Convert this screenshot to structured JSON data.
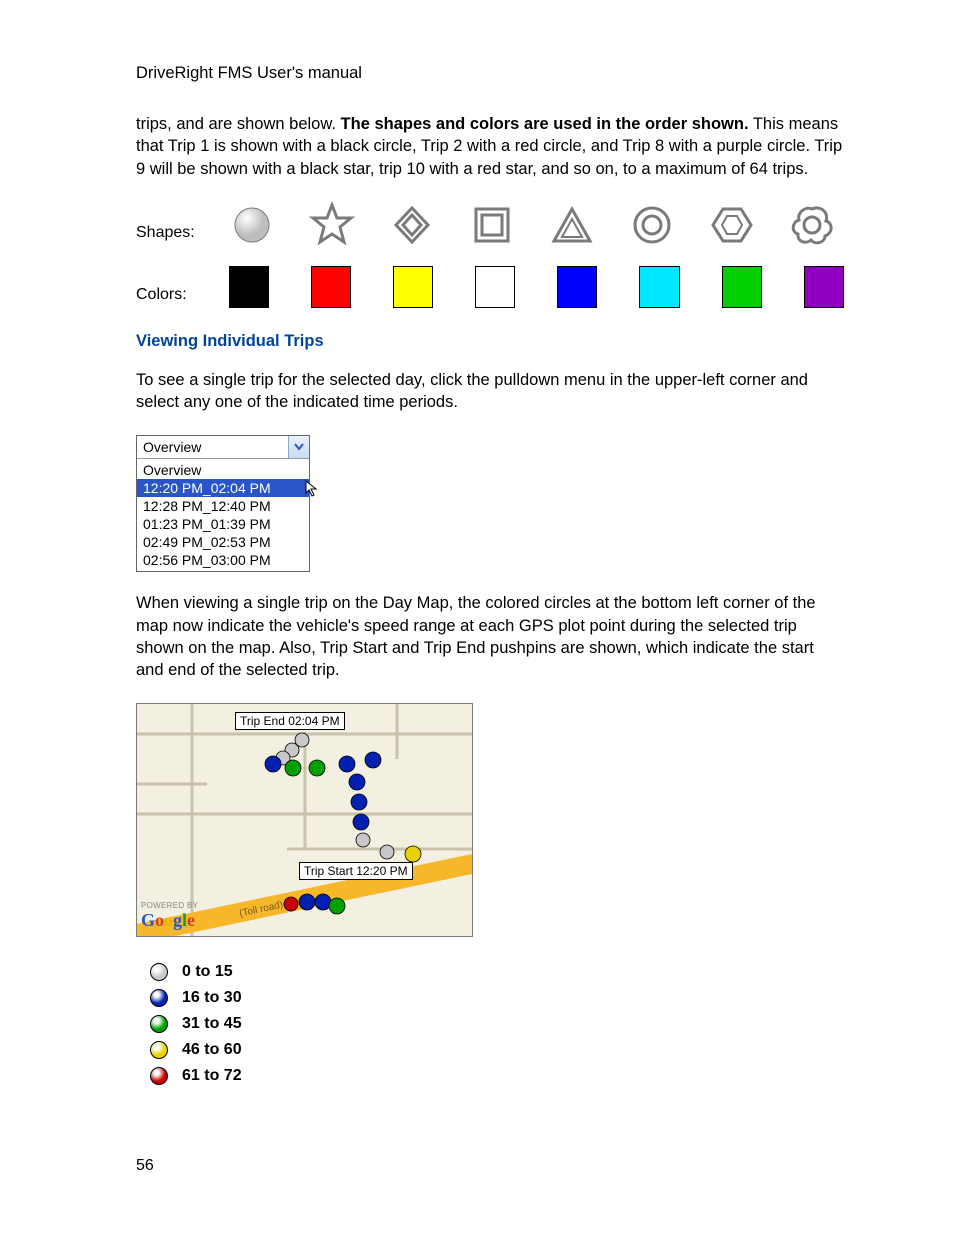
{
  "doc_title": "DriveRight FMS User's manual",
  "page_number": "56",
  "para1_a": "trips, and are shown below. ",
  "para1_bold": "The shapes and colors are used in the order shown.",
  "para1_b": " This means that Trip 1 is shown with a black circle, Trip 2 with a red circle, and Trip 8 with a purple circle. Trip 9 will be shown with a black star, trip 10 with a red star, and so on, to a maximum of 64 trips.",
  "labels": {
    "shapes": "Shapes:",
    "colors": "Colors:"
  },
  "shapes": [
    "circle",
    "star",
    "diamond",
    "square",
    "triangle",
    "double-circle",
    "hexagon",
    "cloud-circle"
  ],
  "colors": [
    "#000000",
    "#ff0000",
    "#ffff00",
    "#ffffff",
    "#0000ff",
    "#00e8ff",
    "#00d000",
    "#9000c0"
  ],
  "section_heading": "Viewing Individual Trips",
  "para2": "To see a single trip for the selected day, click the pulldown menu in the upper-left corner and select any one of the indicated time periods.",
  "dropdown": {
    "selected": "Overview",
    "items": [
      "Overview",
      "12:20 PM_02:04 PM",
      "12:28 PM_12:40 PM",
      "01:23 PM_01:39 PM",
      "02:49 PM_02:53 PM",
      "02:56 PM_03:00 PM"
    ],
    "highlight_index": 1
  },
  "para3": "When viewing a single trip on the Day Map, the colored circles at the bottom left corner of the map now indicate the vehicle's speed range at each GPS plot point during the selected trip shown on the map. Also, Trip Start and Trip End pushpins are shown, which indicate the start and end of the selected trip.",
  "map": {
    "trip_end_label": "Trip End 02:04 PM",
    "trip_start_label": "Trip Start 12:20 PM",
    "toll_text": "(Toll road)",
    "powered_by": "POWERED BY",
    "brand": "Google"
  },
  "speed_legend": [
    {
      "color": "#c8c8c8",
      "label": "0 to 15"
    },
    {
      "color": "#0020b0",
      "label": "16 to 30"
    },
    {
      "color": "#00a000",
      "label": "31 to 45"
    },
    {
      "color": "#e8d000",
      "label": "46 to 60"
    },
    {
      "color": "#c80000",
      "label": "61 to 72"
    }
  ]
}
